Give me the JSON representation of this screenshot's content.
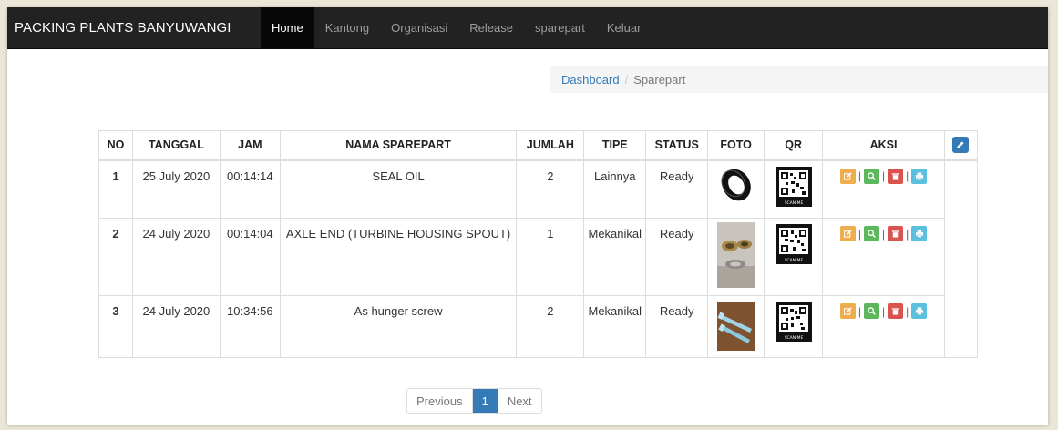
{
  "navbar": {
    "brand": "PACKING PLANTS BANYUWANGI",
    "items": [
      {
        "label": "Home",
        "active": true
      },
      {
        "label": "Kantong",
        "active": false
      },
      {
        "label": "Organisasi",
        "active": false
      },
      {
        "label": "Release",
        "active": false
      },
      {
        "label": "sparepart",
        "active": false
      },
      {
        "label": "Keluar",
        "active": false
      }
    ]
  },
  "breadcrumb": {
    "home": "Dashboard",
    "separator": "/",
    "current": "Sparepart"
  },
  "table": {
    "headers": {
      "no": "NO",
      "tanggal": "TANGGAL",
      "jam": "JAM",
      "nama": "NAMA SPAREPART",
      "jumlah": "JUMLAH",
      "tipe": "TIPE",
      "status": "STATUS",
      "foto": "FOTO",
      "qr": "QR",
      "aksi": "AKSI"
    },
    "rows": [
      {
        "no": "1",
        "tanggal": "25 July 2020",
        "jam": "00:14:14",
        "nama": "SEAL OIL",
        "jumlah": "2",
        "tipe": "Lainnya",
        "status": "Ready",
        "foto": "seal-ring"
      },
      {
        "no": "2",
        "tanggal": "24 July 2020",
        "jam": "00:14:04",
        "nama": "AXLE END (TURBINE HOUSING SPOUT)",
        "jumlah": "1",
        "tipe": "Mekanikal",
        "status": "Ready",
        "foto": "axle-parts"
      },
      {
        "no": "3",
        "tanggal": "24 July 2020",
        "jam": "10:34:56",
        "nama": "As hunger screw",
        "jumlah": "2",
        "tipe": "Mekanikal",
        "status": "Ready",
        "foto": "screw-shafts"
      }
    ],
    "qr_caption": "SCAN ME"
  },
  "action_colors": {
    "edit": "#f0ad4e",
    "view": "#5cb85c",
    "delete": "#d9534f",
    "print": "#5bc0de"
  },
  "pagination": {
    "previous": "Previous",
    "current": "1",
    "next": "Next"
  }
}
